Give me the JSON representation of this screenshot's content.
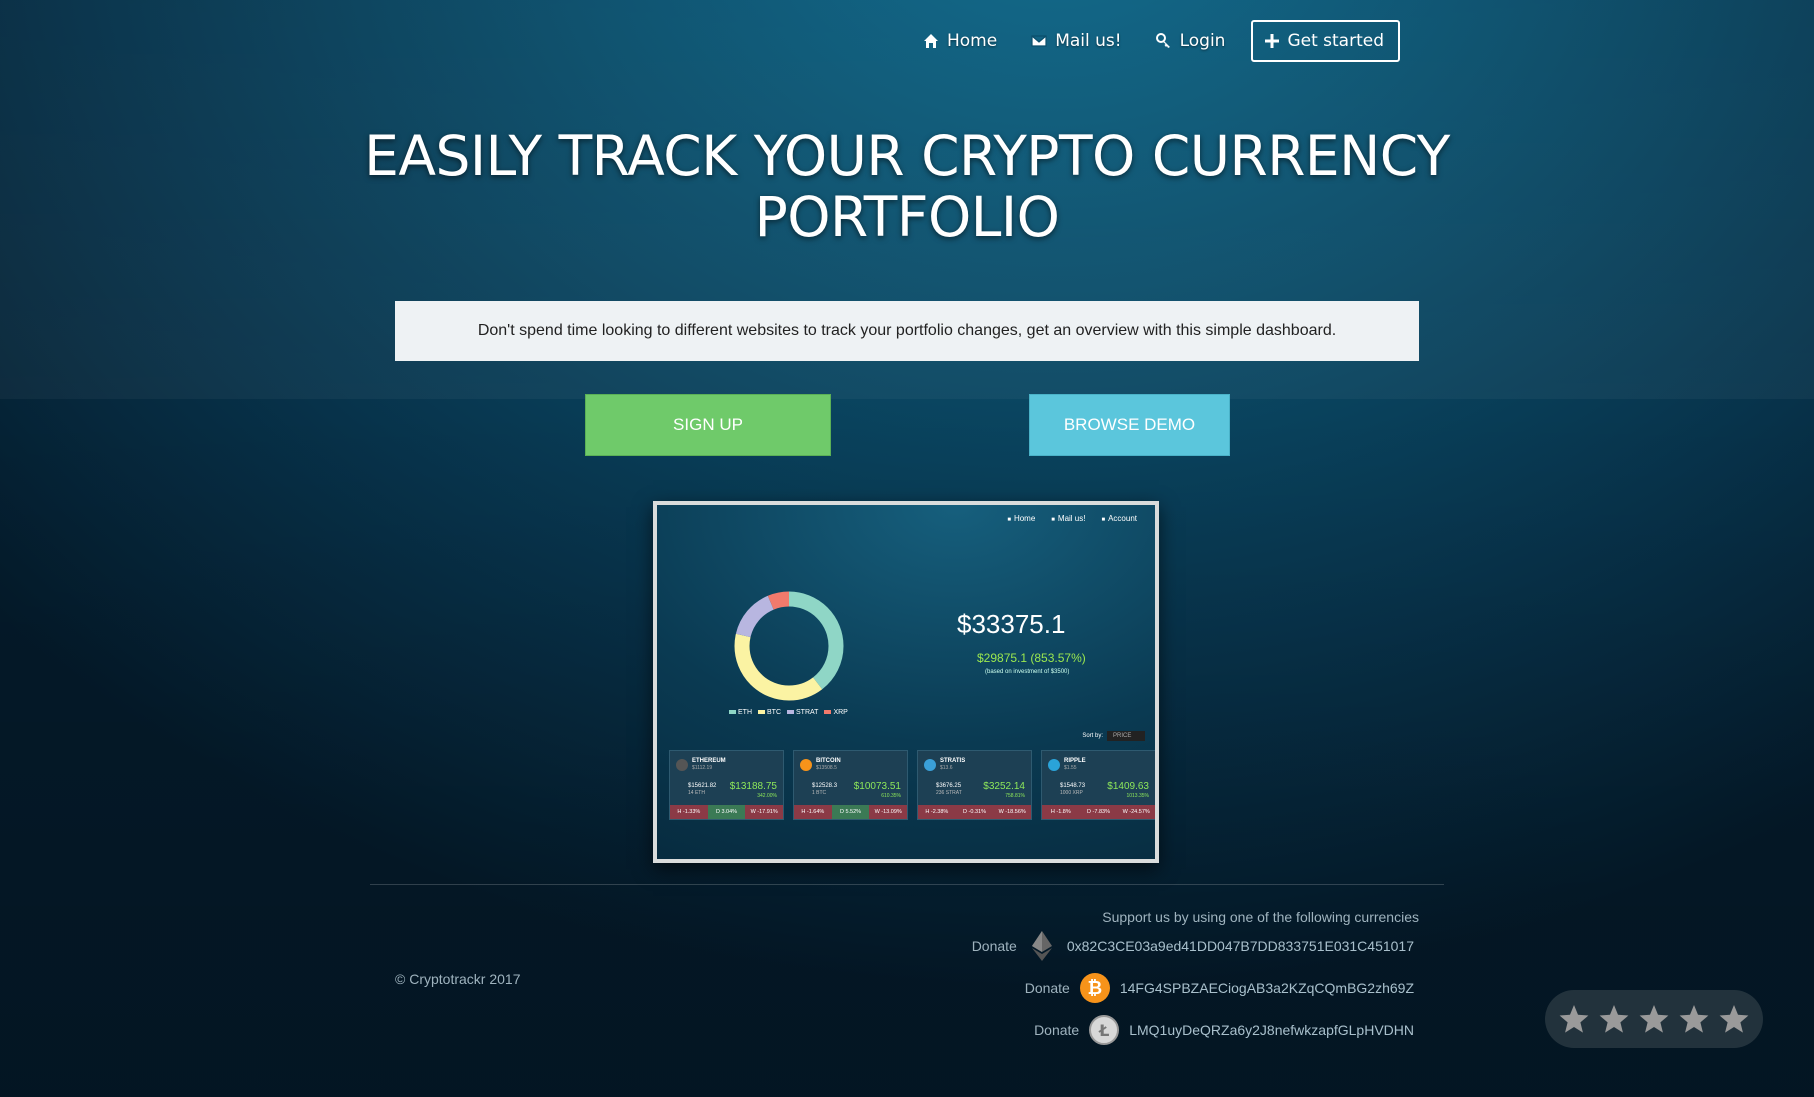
{
  "nav": {
    "home": "Home",
    "mail": "Mail us!",
    "login": "Login",
    "cta": "Get started"
  },
  "hero": {
    "headline_line1": "EASILY TRACK YOUR CRYPTO CURRENCY",
    "headline_line2": "PORTFOLIO",
    "tagline": "Don't spend time looking to different websites to track your portfolio changes, get an overview with this simple dashboard.",
    "signup_label": "SIGN UP",
    "demo_label": "BROWSE DEMO"
  },
  "preview": {
    "nav": [
      "Home",
      "Mail us!",
      "Account"
    ],
    "total": "$33375.1",
    "change": "$29875.1 (853.57%)",
    "note": "(based on investment of $3500)",
    "legend": [
      {
        "label": "ETH",
        "color": "#8fd6c6"
      },
      {
        "label": "BTC",
        "color": "#fbf3a3"
      },
      {
        "label": "STRAT",
        "color": "#b8b6e0"
      },
      {
        "label": "XRP",
        "color": "#f27a6c"
      }
    ],
    "donut_fractions": [
      0.395,
      0.39,
      0.15,
      0.065
    ],
    "sort_label": "Sort by:",
    "sort_value": "PRICE",
    "cards": [
      {
        "name": "ETHEREUM",
        "price": "$1112.19",
        "hold": "$15621.82",
        "amount": "14 ETH",
        "value": "$13188.75",
        "pct": "342.00%",
        "h": "H -1.33%",
        "d": "D 3.04%",
        "w": "W -17.91%",
        "icon_color": "#555555"
      },
      {
        "name": "BITCOIN",
        "price": "$13508.5",
        "hold": "$12528.3",
        "amount": "1 BTC",
        "value": "$10073.51",
        "pct": "610.35%",
        "h": "H -1.64%",
        "d": "D 5.52%",
        "w": "W -13.09%",
        "icon_color": "#f7931a"
      },
      {
        "name": "STRATIS",
        "price": "$13.6",
        "hold": "$3676.25",
        "amount": "236 STRAT",
        "value": "$3252.14",
        "pct": "758.81%",
        "h": "H -2.38%",
        "d": "D -0.31%",
        "w": "W -18.56%",
        "icon_color": "#3aa0d8"
      },
      {
        "name": "RIPPLE",
        "price": "$1.55",
        "hold": "$1548.73",
        "amount": "1000 XRP",
        "value": "$1409.63",
        "pct": "1013.35%",
        "h": "H -1.8%",
        "d": "D -7.83%",
        "w": "W -24.57%",
        "icon_color": "#2aa3d9"
      }
    ]
  },
  "footer": {
    "copyright": "© Cryptotrackr 2017",
    "support": "Support us by using one of the following currencies",
    "donations": [
      {
        "label": "Donate",
        "coin": "ethereum-icon",
        "address": "0x82C3CE03a9ed41DD047B7DD833751E031C451017"
      },
      {
        "label": "Donate",
        "coin": "bitcoin-icon",
        "address": "14FG4SPBZAECiogAB3a2KZqCQmBG2zh69Z"
      },
      {
        "label": "Donate",
        "coin": "litecoin-icon",
        "address": "LMQ1uyDeQRZa6y2J8nefwkzapfGLpHVDHN"
      }
    ]
  },
  "rating": {
    "stars": 5,
    "filled": 0
  }
}
